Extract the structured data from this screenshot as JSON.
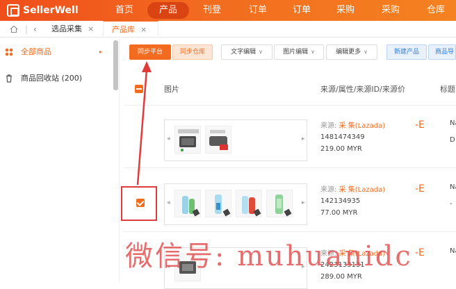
{
  "app": {
    "brand": "SellerWell"
  },
  "nav": {
    "items": [
      "首页",
      "产品",
      "刊登",
      "订单",
      "订单",
      "采购",
      "采购",
      "仓库"
    ],
    "active_index": 1
  },
  "tabs": {
    "items": [
      {
        "label": "选品采集",
        "close": "×"
      },
      {
        "label": "产品库",
        "close": "×"
      }
    ],
    "active_index": 1
  },
  "sidebar": {
    "items": [
      {
        "label": "全部商品",
        "active": true,
        "icon": "category-icon"
      },
      {
        "label": "商品回收站 (200)",
        "active": false,
        "icon": "trash-icon"
      }
    ]
  },
  "toolbar": {
    "sync_platform": "同步平台",
    "sync_warehouse": "同步仓库",
    "text_edit": "文字编辑",
    "image_edit": "图片编辑",
    "edit_more": "编辑更多",
    "new_product": "新建产品",
    "product_import": "商品导"
  },
  "table": {
    "headers": {
      "image": "图片",
      "source": "来源/属性/来源ID/来源价",
      "title": "标题"
    },
    "rows": [
      {
        "source_label": "来源:",
        "source_value": "采 集(Lazada)",
        "id": "1481474349",
        "price": "219.00  MYR",
        "title_trunc": "Na",
        "title_trunc2": "D"
      },
      {
        "source_label": "来源:",
        "source_value": "采 集(Lazada)",
        "id": "142134935",
        "price": "77.00  MYR",
        "title_trunc": "Na",
        "title_trunc2": "-"
      },
      {
        "source_label": "来源:",
        "source_value": "采 集(Lazada)",
        "id": "2423133131",
        "price": "289.00  MYR",
        "title_trunc": "Na",
        "title_trunc2": ""
      }
    ]
  },
  "watermark": "微信号: muhuanidc",
  "colors": {
    "brand": "#f26b1f",
    "nav_bg": "#f04e1a",
    "highlight": "#e03a3a",
    "blue": "#2f7de1"
  }
}
